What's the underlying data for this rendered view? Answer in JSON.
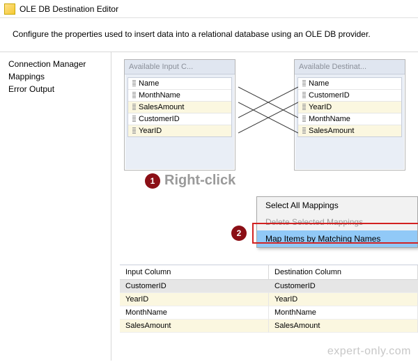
{
  "window": {
    "title": "OLE DB Destination Editor",
    "description": "Configure the properties used to insert data into a relational database using an OLE DB provider."
  },
  "nav": {
    "items": [
      "Connection Manager",
      "Mappings",
      "Error Output"
    ]
  },
  "diagram": {
    "input": {
      "header": "Available Input C...",
      "columns": [
        "Name",
        "MonthName",
        "SalesAmount",
        "CustomerID",
        "YearID"
      ]
    },
    "destination": {
      "header": "Available Destinat...",
      "columns": [
        "Name",
        "CustomerID",
        "YearID",
        "MonthName",
        "SalesAmount"
      ]
    }
  },
  "annotations": {
    "step1": {
      "num": "1",
      "label": "Right-click"
    },
    "step2": {
      "num": "2"
    }
  },
  "context_menu": {
    "items": [
      {
        "label": "Select All Mappings",
        "enabled": true,
        "highlight": false
      },
      {
        "label": "Delete Selected Mappings",
        "enabled": false,
        "highlight": false
      },
      {
        "label": "Map Items by Matching Names",
        "enabled": true,
        "highlight": true
      }
    ]
  },
  "mapping_grid": {
    "headers": [
      "Input Column",
      "Destination Column"
    ],
    "rows": [
      {
        "input": "CustomerID",
        "dest": "CustomerID",
        "sel": true,
        "alt": false
      },
      {
        "input": "YearID",
        "dest": "YearID",
        "sel": false,
        "alt": true
      },
      {
        "input": "MonthName",
        "dest": "MonthName",
        "sel": false,
        "alt": false
      },
      {
        "input": "SalesAmount",
        "dest": "SalesAmount",
        "sel": false,
        "alt": true
      }
    ]
  },
  "watermark": "expert-only.com"
}
